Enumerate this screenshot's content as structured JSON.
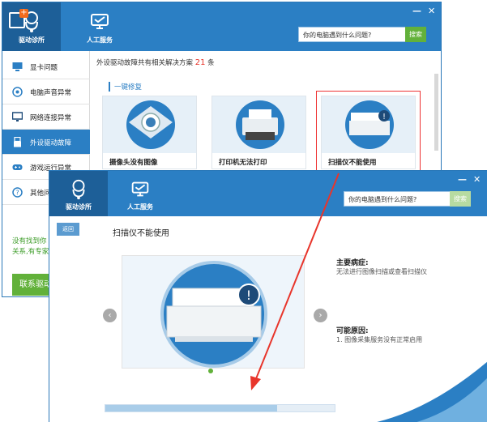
{
  "window1": {
    "tabs": [
      {
        "label": "驱动诊所",
        "icon": "stethoscope-icon",
        "active": true
      },
      {
        "label": "人工服务",
        "icon": "support-icon",
        "active": false
      }
    ],
    "controls": {
      "minimize": "—",
      "close": "✕"
    },
    "search": {
      "placeholder": "你的电脑遇到什么问题?",
      "button": "搜索"
    },
    "sidebar": {
      "items": [
        {
          "label": "显卡问题",
          "icon": "display-card-icon"
        },
        {
          "label": "电脑声音异常",
          "icon": "speaker-icon"
        },
        {
          "label": "网络连接异常",
          "icon": "monitor-icon"
        },
        {
          "label": "外设驱动故障",
          "icon": "usb-icon",
          "active": true
        },
        {
          "label": "游戏运行异常",
          "icon": "gamepad-icon"
        },
        {
          "label": "其他问",
          "icon": "question-icon"
        }
      ],
      "help_line1": "没有找到你",
      "help_line2": "关系,有专家",
      "contact_button": "联系驱动"
    },
    "count_prefix": "外设驱动故障共有相关解决方案",
    "count_value": "21",
    "count_suffix": "条",
    "section_title": "一键修复",
    "cards": [
      {
        "label": "摄像头没有图像",
        "icon": "webcam-icon"
      },
      {
        "label": "打印机无法打印",
        "icon": "printer-icon"
      },
      {
        "label": "扫描仪不能使用",
        "icon": "scanner-icon",
        "selected": true
      }
    ]
  },
  "window2": {
    "tabs": [
      {
        "label": "驱动诊所",
        "icon": "stethoscope-icon",
        "active": true
      },
      {
        "label": "人工服务",
        "icon": "support-icon",
        "active": false
      }
    ],
    "controls": {
      "minimize": "—",
      "close": "✕"
    },
    "search": {
      "placeholder": "你的电脑遇到什么问题?",
      "button": "搜索"
    },
    "back_button": "返回",
    "page_title": "扫描仪不能使用",
    "nav_prev": "‹",
    "nav_next": "›",
    "symptom_title": "主要病症:",
    "symptom_text": "无法进行图像扫描或查看扫描仪",
    "cause_title": "可能原因:",
    "cause_text": "1. 图像采集服务没有正常启用",
    "progress_fraction": 0.75
  },
  "colors": {
    "primary": "#2b7fc4",
    "primary_dark": "#1d5f98",
    "accent_green": "#62b13a",
    "highlight_red": "#e8352b"
  }
}
